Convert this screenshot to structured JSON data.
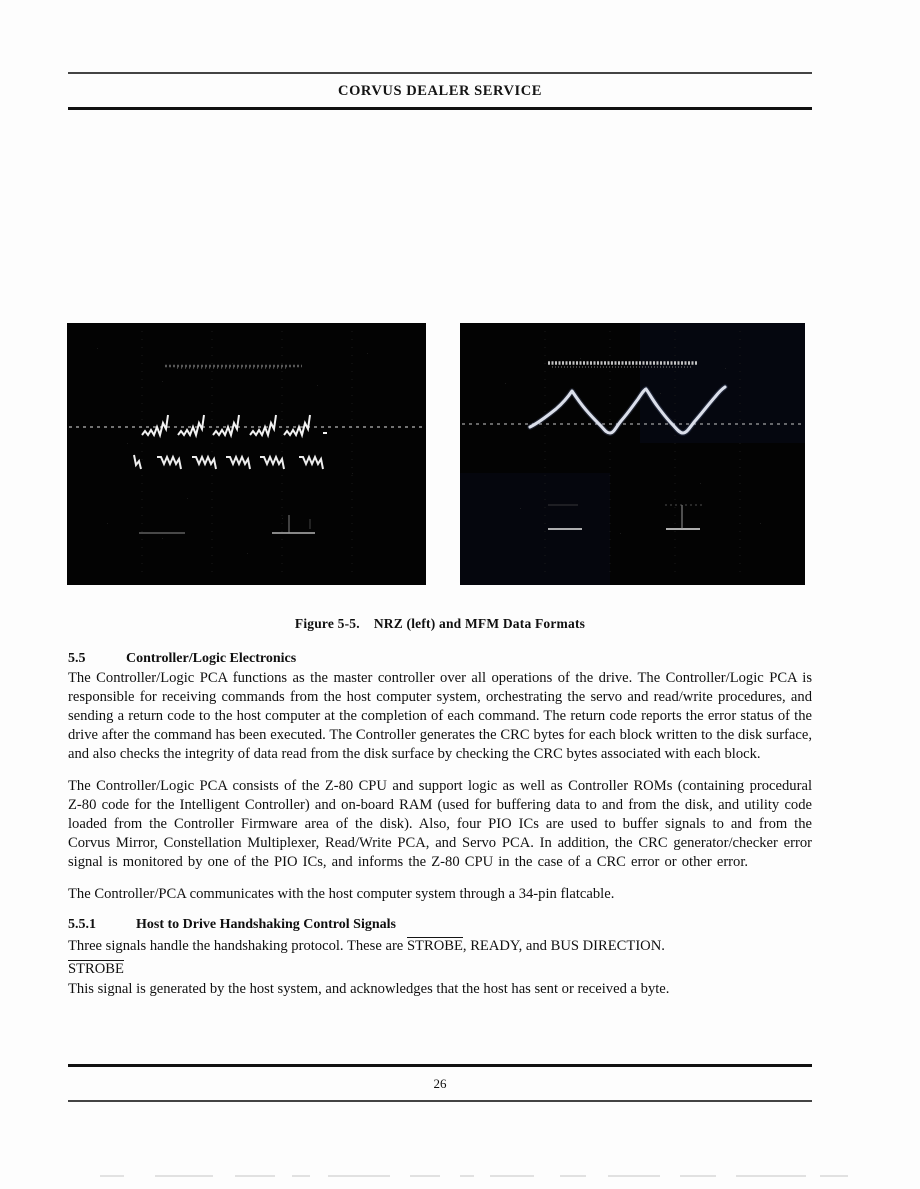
{
  "header": {
    "title": "CORVUS DEALER SERVICE"
  },
  "figure": {
    "caption_number": "Figure 5-5.",
    "caption_text": "NRZ (left) and MFM Data Formats",
    "left_photo_name": "NRZ data format oscilloscope trace",
    "right_photo_name": "MFM data format oscilloscope trace"
  },
  "sections": [
    {
      "number": "5.5",
      "title": "Controller/Logic Electronics"
    },
    {
      "number": "5.5.1",
      "title": "Host to Drive Handshaking Control Signals"
    }
  ],
  "paragraphs": {
    "p1": "The Controller/Logic PCA functions as the master controller over all operations of the drive. The Controller/Logic PCA is responsible for receiving commands from the host computer system, orchestrating the servo and read/write procedures, and sending a return code to the host computer at the completion of each command. The return code reports the error status of the drive after the command has been executed. The Controller generates the CRC bytes for each block written to the disk surface, and also checks the integrity of data read from the disk surface by checking the CRC bytes associated with each block.",
    "p2": "The Controller/Logic PCA consists of the Z-80 CPU and support logic as well as Controller ROMs (containing procedural Z-80 code for the Intelligent Controller) and on-board RAM (used for buffering data to and from the disk, and utility code loaded from the Controller Firmware area of the disk). Also, four PIO ICs are used to buffer signals to and from the Corvus Mirror, Constellation Multiplexer, Read/Write PCA, and Servo PCA. In addition, the CRC generator/checker error signal is monitored by one of the PIO ICs, and informs the Z-80 CPU in the case of a CRC error or other error.",
    "p3": "The Controller/PCA communicates with the host computer system through a 34-pin flatcable.",
    "p4_prefix": "Three signals handle the handshaking protocol. These are ",
    "p4_signal_overlined": "STROBE",
    "p4_suffix": ", READY, and BUS DIRECTION.",
    "term_strobe": "STROBE",
    "p5": "This signal is generated by the host system, and acknowledges that the host has sent or received a byte."
  },
  "footer": {
    "page_number": "26"
  }
}
